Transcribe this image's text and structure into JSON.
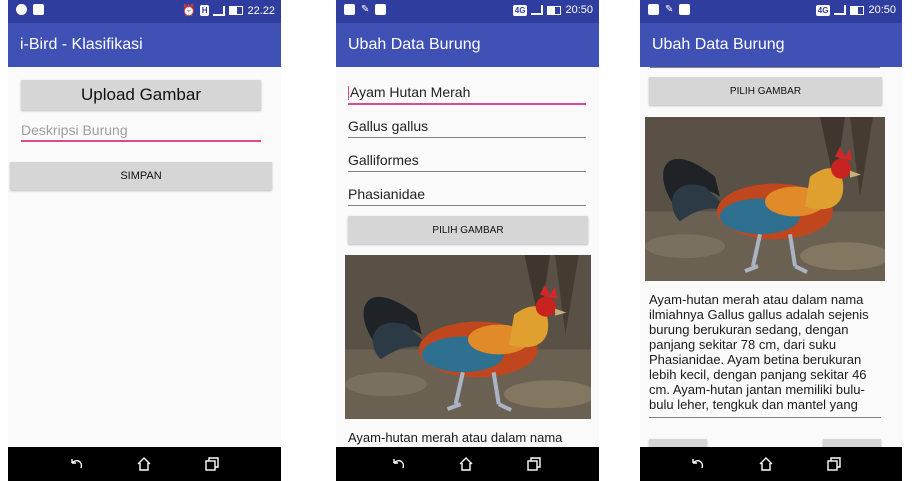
{
  "screen1": {
    "status_time": "22.22",
    "status_badge": "H",
    "title": "i-Bird - Klasifikasi",
    "upload_label": "Upload Gambar",
    "desc_placeholder": "Deskripsi Burung",
    "save_label": "SIMPAN"
  },
  "screen2": {
    "status_time": "20:50",
    "status_badge": "4G",
    "title": "Ubah Data Burung",
    "fields": [
      "Ayam Hutan Merah",
      "Gallus gallus",
      "Galliformes",
      "Phasianidae"
    ],
    "pick_label": "PILIH GAMBAR",
    "desc_line": "Ayam-hutan merah atau dalam nama"
  },
  "screen3": {
    "status_time": "20:50",
    "status_badge": "4G",
    "title": "Ubah Data Burung",
    "pick_label": "PILIH GAMBAR",
    "description_lines": [
      "Ayam-hutan merah atau dalam nama",
      "ilmiahnya Gallus gallus adalah sejenis",
      "burung berukuran sedang, dengan",
      "panjang sekitar 78 cm, dari suku",
      "Phasianidae. Ayam betina berukuran",
      "lebih kecil, dengan panjang sekitar 46",
      "cm. Ayam-hutan jantan memiliki bulu-",
      "bulu leher, tengkuk dan mantel yang"
    ]
  },
  "colors": {
    "app_bar": "#3f51b5",
    "status_bar": "#2f3e9e",
    "accent": "#e0488c",
    "button": "#d6d6d6"
  },
  "icons": [
    "back-icon",
    "home-icon",
    "recents-icon",
    "alarm-icon",
    "signal-icon",
    "battery-icon"
  ]
}
